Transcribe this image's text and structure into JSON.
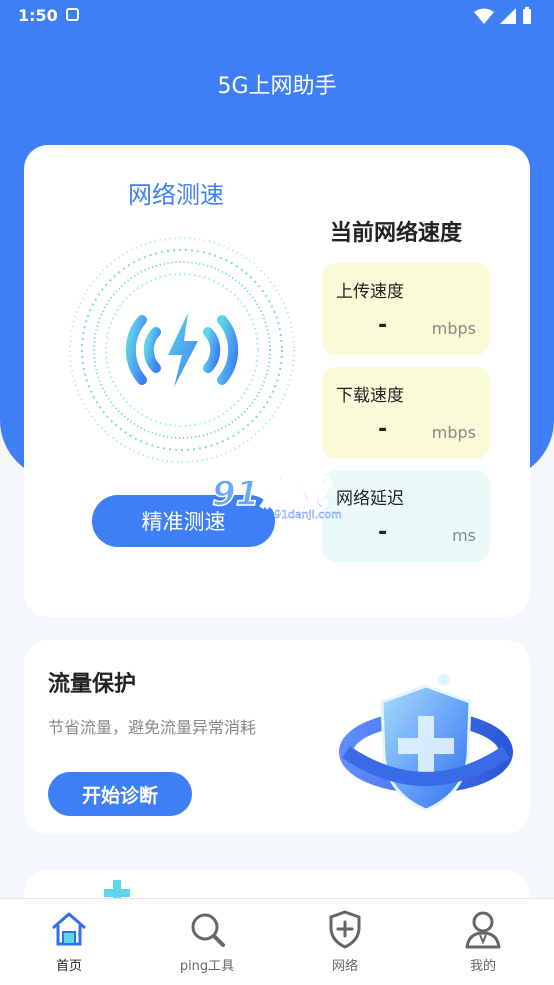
{
  "status_bar": {
    "time": "1:50"
  },
  "app": {
    "title": "5G上网助手"
  },
  "speed_card": {
    "title": "网络测速",
    "button_label": "精准测速",
    "current_heading": "当前网络速度",
    "metrics": [
      {
        "label": "上传速度",
        "value": "-",
        "unit": "mbps"
      },
      {
        "label": "下载速度",
        "value": "-",
        "unit": "mbps"
      },
      {
        "label": "网络延迟",
        "value": "-",
        "unit": "ms"
      }
    ]
  },
  "flow_card": {
    "title": "流量保护",
    "description": "节省流量，避免流量异常消耗",
    "button_label": "开始诊断"
  },
  "watermark": {
    "text": "91游戏",
    "sub": "91danji.com"
  },
  "tabs": [
    {
      "label": "首页",
      "icon": "home-icon",
      "active": true
    },
    {
      "label": "ping工具",
      "icon": "search-icon",
      "active": false
    },
    {
      "label": "网络",
      "icon": "shield-plus-icon",
      "active": false
    },
    {
      "label": "我的",
      "icon": "user-icon",
      "active": false
    }
  ],
  "colors": {
    "primary": "#3f7ff5",
    "metric_yellow": "#f9fbd6",
    "metric_cyan": "#eafaf8",
    "page_bg": "#f4f7fb"
  }
}
